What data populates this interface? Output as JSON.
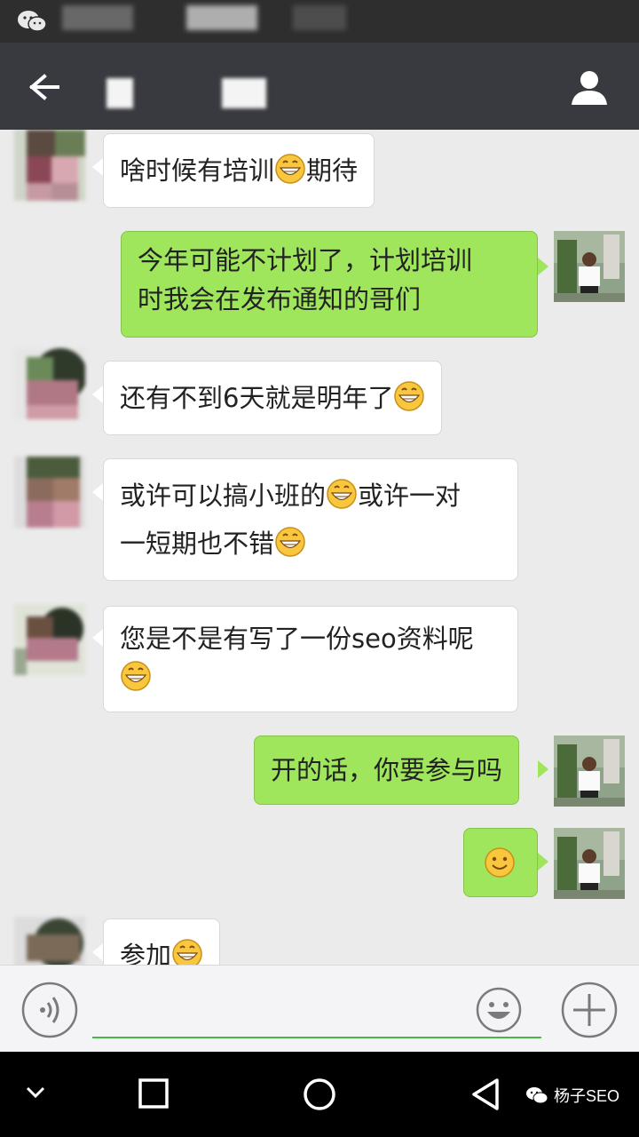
{
  "messages": [
    {
      "side": "left",
      "text": "啥时候有培训",
      "suffix_emoji": "grin-emoji",
      "text_after": "期待"
    },
    {
      "side": "right",
      "lines": [
        "今年可能不计划了，计划培训",
        "时我会在发布通知的哥们"
      ]
    },
    {
      "side": "left",
      "text": "还有不到6天就是明年了",
      "suffix_emoji": "grin-emoji"
    },
    {
      "side": "left",
      "lines": [
        "或许可以搞小班的",
        "一短期也不错"
      ],
      "line1_tail": "或许一对"
    },
    {
      "side": "left",
      "lines": [
        "您是不是有写了一份seo资料呢"
      ]
    },
    {
      "side": "right",
      "text": "开的话，你要参与吗"
    },
    {
      "side": "right",
      "emoji_only": "smile-emoji"
    },
    {
      "side": "left",
      "text": "参加"
    }
  ],
  "watermark": {
    "text": "杨子SEO"
  },
  "colors": {
    "sent_bubble": "#9fe65c",
    "received_bubble": "#ffffff",
    "top_bar": "#393a3f",
    "chat_bg": "#ebebeb"
  }
}
